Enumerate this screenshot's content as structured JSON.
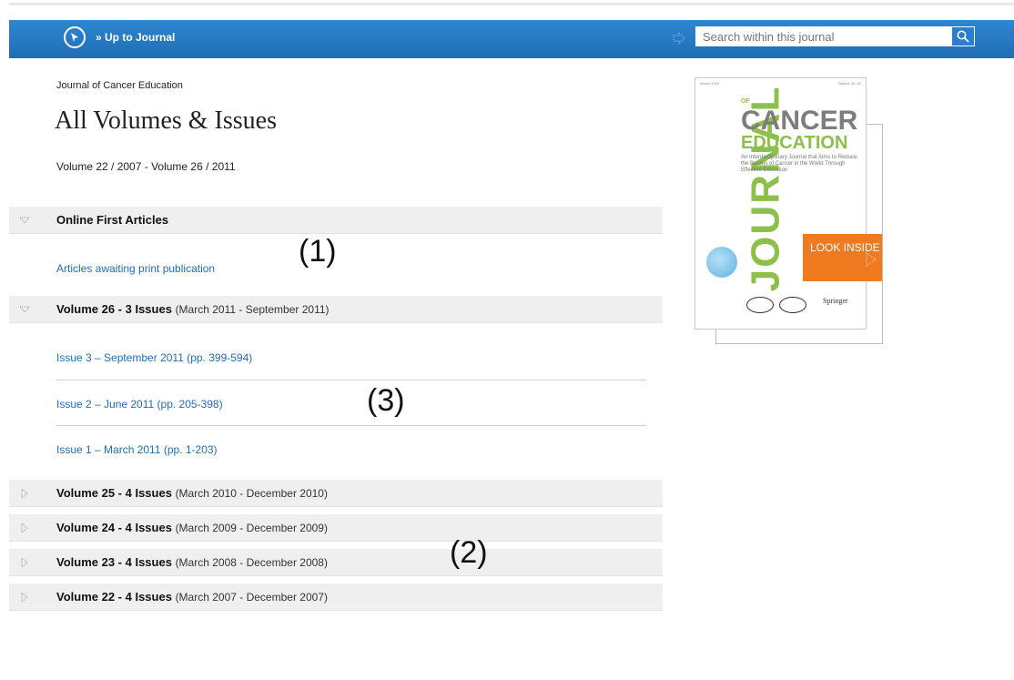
{
  "header": {
    "up_link": "» Up to Journal",
    "search_placeholder": "Search within this journal"
  },
  "journal": {
    "name": "Journal of Cancer Education",
    "title": "All Volumes & Issues",
    "range": "Volume 22 / 2007 - Volume 26 / 2011"
  },
  "sections": {
    "online_first": {
      "label": "Online First Articles",
      "link": "Articles awaiting print publication"
    },
    "volume26": {
      "label": "Volume 26 - 3 Issues",
      "dates": "(March 2011 - September 2011)",
      "issues": [
        "Issue 3 – September 2011 (pp. 399-594)",
        "Issue 2 – June 2011 (pp. 205-398)",
        "Issue 1 – March 2011 (pp. 1-203)"
      ]
    },
    "volume25": {
      "label": "Volume 25 - 4 Issues",
      "dates": "(March 2010 - December 2010)"
    },
    "volume24": {
      "label": "Volume 24 - 4 Issues",
      "dates": "(March 2009 - December 2009)"
    },
    "volume23": {
      "label": "Volume 23 - 4 Issues",
      "dates": "(March 2008 - December 2008)"
    },
    "volume22": {
      "label": "Volume 22 - 4 Issues",
      "dates": "(March 2007 - December 2007)"
    }
  },
  "annotations": {
    "a1": "(1)",
    "a2": "(2)",
    "a3": "(3)"
  },
  "cover": {
    "vertical_word": "JOURNAL",
    "of": "OF",
    "cancer": "CANCER",
    "education": "EDUCATION",
    "tagline": "An Interdisciplinary Journal that Aims to Reduce the Burden of Cancer in the World Through Effective Education",
    "date": "March 2010",
    "volume": "Volume 25, #1",
    "publisher": "Springer",
    "look_inside": "LOOK INSIDE"
  },
  "colors": {
    "accent": "#1f6db6",
    "cover_green": "#8cc04a",
    "look_orange": "#ef7a1f"
  }
}
